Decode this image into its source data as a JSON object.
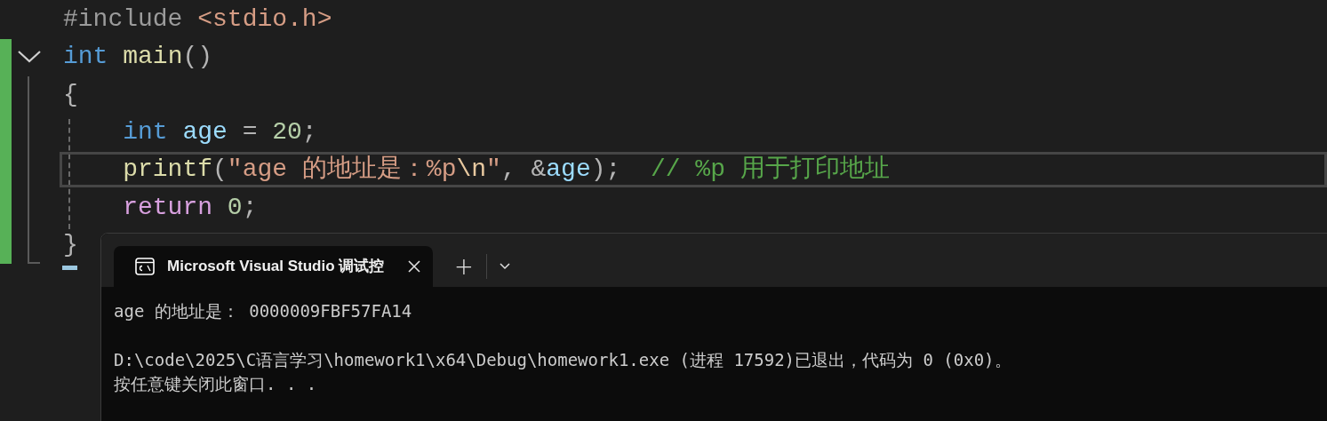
{
  "editor": {
    "lines": [
      {
        "indented": false,
        "current": false,
        "fold": false,
        "tokens": [
          {
            "text": "#include ",
            "kind": "directive"
          },
          {
            "text": "<stdio.h>",
            "kind": "string"
          }
        ]
      },
      {
        "indented": false,
        "current": false,
        "fold": true,
        "tokens": [
          {
            "text": "int ",
            "kind": "keyword"
          },
          {
            "text": "main",
            "kind": "function"
          },
          {
            "text": "()",
            "kind": "punct"
          }
        ]
      },
      {
        "indented": false,
        "current": false,
        "fold": false,
        "tokens": [
          {
            "text": "{",
            "kind": "punct"
          }
        ]
      },
      {
        "indented": true,
        "current": false,
        "fold": false,
        "tokens": [
          {
            "text": "int ",
            "kind": "keyword"
          },
          {
            "text": "age",
            "kind": "variable"
          },
          {
            "text": " = ",
            "kind": "punct"
          },
          {
            "text": "20",
            "kind": "number"
          },
          {
            "text": ";",
            "kind": "punct"
          }
        ]
      },
      {
        "indented": true,
        "current": true,
        "fold": false,
        "tokens": [
          {
            "text": "printf",
            "kind": "function"
          },
          {
            "text": "(",
            "kind": "punct"
          },
          {
            "text": "\"age 的地址是：%p",
            "kind": "string"
          },
          {
            "text": "\\n",
            "kind": "escape"
          },
          {
            "text": "\"",
            "kind": "string"
          },
          {
            "text": ", &",
            "kind": "punct"
          },
          {
            "text": "age",
            "kind": "variable"
          },
          {
            "text": ");  ",
            "kind": "punct"
          },
          {
            "text": "// %p 用于打印地址",
            "kind": "comment"
          }
        ]
      },
      {
        "indented": true,
        "current": false,
        "fold": false,
        "tokens": [
          {
            "text": "return ",
            "kind": "control"
          },
          {
            "text": "0",
            "kind": "number"
          },
          {
            "text": ";",
            "kind": "punct"
          }
        ]
      },
      {
        "indented": false,
        "current": false,
        "fold": false,
        "tokens": [
          {
            "text": "}",
            "kind": "punct"
          }
        ]
      }
    ]
  },
  "terminal": {
    "tab_title": "Microsoft Visual Studio 调试控",
    "new_tab": "+",
    "output": [
      [
        "age 的地址是： 0000009FBF57FA14"
      ],
      [
        "D:\\code\\2025\\C语言学习\\homework1\\x64\\Debug\\homework1.exe (进程 17592)已退出，代码为 0 (0x0)。",
        "按任意键关闭此窗口. . ."
      ]
    ]
  }
}
